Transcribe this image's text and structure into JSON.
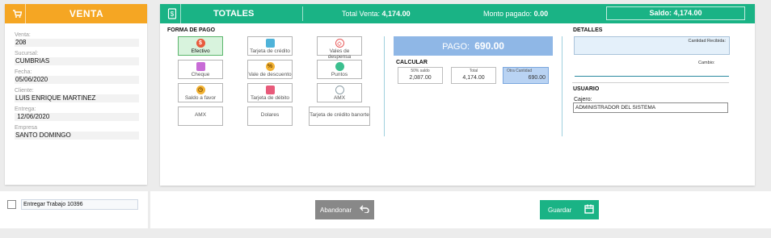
{
  "venta": {
    "title": "VENTA",
    "fields": [
      {
        "label": "Venta:",
        "value": "208"
      },
      {
        "label": "Sucursal:",
        "value": "CUMBRIAS"
      },
      {
        "label": "Fecha:",
        "value": "05/06/2020"
      },
      {
        "label": "Cliente:",
        "value": "LUIS ENRIQUE MARTINEZ"
      },
      {
        "label": "Entrega:",
        "value": " 12/06/2020"
      },
      {
        "label": "Empresa",
        "value": "SANTO DOMINGO"
      }
    ]
  },
  "totales": {
    "title": "TOTALES",
    "total_venta_label": "Total Venta: ",
    "total_venta": "4,174.00",
    "monto_pagado_label": "Monto pagado: ",
    "monto_pagado": "0.00",
    "saldo_label": "Saldo: ",
    "saldo": "4,174.00"
  },
  "forma_pago": {
    "title": "FORMA DE PAGO",
    "buttons": [
      {
        "label": "Efectivo",
        "icon": "coin-icon",
        "color": "#e85a3c",
        "glyph": "$",
        "active": true
      },
      {
        "label": "Tarjeta de crédito",
        "icon": "credit-card-icon",
        "color": "#4fb3d9",
        "glyph": "▭",
        "active": false
      },
      {
        "label": "Vales de despensa",
        "icon": "ticket-icon",
        "color": "#e85a5a",
        "glyph": "◇",
        "active": false
      },
      {
        "label": "Cheque",
        "icon": "cheque-icon",
        "color": "#c86bd6",
        "glyph": "▭",
        "active": false
      },
      {
        "label": "Vale de descuento",
        "icon": "percent-icon",
        "color": "#f2b233",
        "glyph": "%",
        "active": false
      },
      {
        "label": "Puntos",
        "icon": "points-icon",
        "color": "#3bbf8f",
        "glyph": "●",
        "active": false
      },
      {
        "label": "Saldo a favor",
        "icon": "clock-icon",
        "color": "#f2b233",
        "glyph": "◷",
        "active": false
      },
      {
        "label": "Tarjeta de débito",
        "icon": "debit-card-icon",
        "color": "#e85a7a",
        "glyph": "▭",
        "active": false
      },
      {
        "label": "AMX",
        "icon": "amx-icon",
        "color": "#8fa0a8",
        "glyph": "○",
        "active": false
      },
      {
        "label": "AMX",
        "icon": "amx-icon",
        "color": "#8fa0a8",
        "glyph": "",
        "active": false
      },
      {
        "label": "Dolares",
        "icon": "dollar-icon",
        "color": "#8fa0a8",
        "glyph": "",
        "active": false
      },
      {
        "label": "Tarjeta de crédito banorte",
        "icon": "card-icon",
        "color": "#8fa0a8",
        "glyph": "",
        "active": false
      }
    ]
  },
  "pago": {
    "label": "PAGO:",
    "value": "690.00"
  },
  "calcular": {
    "title": "CALCULAR",
    "items": [
      {
        "label": "50% saldo",
        "value": "2,087.00"
      },
      {
        "label": "Total",
        "value": "4,174.00"
      },
      {
        "label": "Otra Cantidad",
        "value": "690.00"
      }
    ]
  },
  "detalles": {
    "title": "DETALLES",
    "cantidad_recibida_label": "Cantidad Recibida:",
    "cambio_label": "Cambio:"
  },
  "usuario": {
    "title": "USUARIO",
    "cajero_label": "Cajero:",
    "cajero_value": "ADMINISTRADOR DEL SISTEMA"
  },
  "footer": {
    "entregar_label": "Entregar Trabajo 10396",
    "abandonar_label": "Abandonar",
    "guardar_label": "Guardar"
  },
  "colors": {
    "venta_accent": "#f5a623",
    "totales_accent": "#1ab385",
    "pago_box": "#8fb7e6"
  }
}
